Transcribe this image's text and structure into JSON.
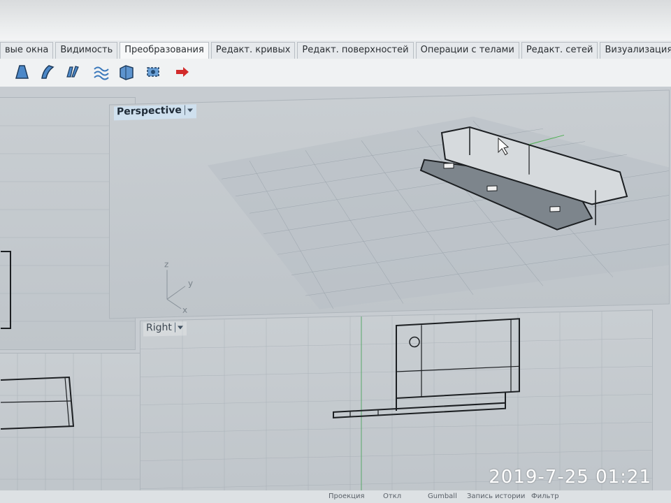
{
  "tabs": [
    {
      "label": "вые окна",
      "active": false
    },
    {
      "label": "Видимость",
      "active": false
    },
    {
      "label": "Преобразования",
      "active": true
    },
    {
      "label": "Редакт. кривых",
      "active": false
    },
    {
      "label": "Редакт. поверхностей",
      "active": false
    },
    {
      "label": "Операции с телами",
      "active": false
    },
    {
      "label": "Редакт. сетей",
      "active": false
    },
    {
      "label": "Визуализация",
      "active": false
    }
  ],
  "toolbar": {
    "icons": [
      "bevel-icon",
      "bend-icon",
      "twist-icon",
      "flow-icon",
      "box-edit-icon",
      "gumball-box-icon",
      "arrow-right-icon"
    ]
  },
  "viewports": {
    "perspective": {
      "label": "Perspective"
    },
    "right": {
      "label": "Right"
    }
  },
  "axes": {
    "x": "x",
    "y": "y",
    "z": "z"
  },
  "status": {
    "items": [
      "Проекция",
      "Откл",
      "Gumball",
      "Запись истории",
      "Фильтр"
    ]
  },
  "timestamp": "2019-7-25 01:21",
  "colors": {
    "accent": "#cfe0ee",
    "grid": "#9aa3ab",
    "model": "#1c1f22"
  }
}
